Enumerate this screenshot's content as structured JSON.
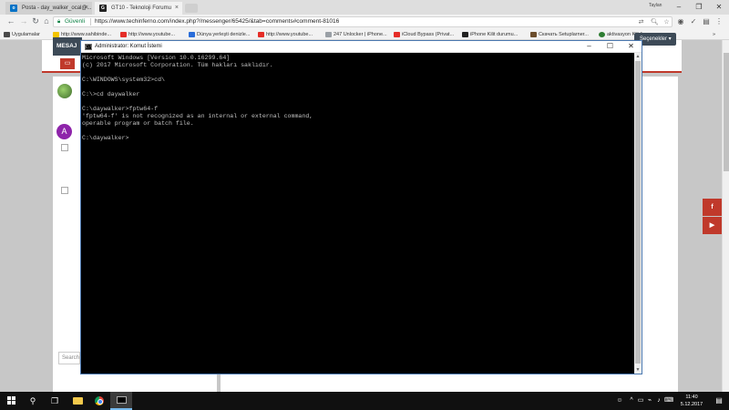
{
  "browser": {
    "tabs": [
      {
        "title": "Posta - day_walker_ocal@...",
        "active": false,
        "favicon": "outlook-icon"
      },
      {
        "title": "GT10 - Teknoloji Forumu",
        "active": true,
        "favicon": "gt-icon"
      }
    ],
    "user_label": "Taylan",
    "security_label": "Güvenli",
    "url": "https://www.techinferno.com/index.php?/messenger/65425/&tab=comments#comment-81016",
    "bookmarks": [
      {
        "label": "Uygulamalar",
        "icon": "apps-grid-icon",
        "color": "#4a4a4a"
      },
      {
        "label": "http://www.sahibinde...",
        "icon": "sahibinden-icon",
        "color": "#f4c400"
      },
      {
        "label": "http://www.youtube...",
        "icon": "youtube-icon",
        "color": "#e52d27"
      },
      {
        "label": "Dünya yerleşti denizle...",
        "icon": "doc-icon",
        "color": "#2a6dd9"
      },
      {
        "label": "http://www.youtube...",
        "icon": "youtube-icon",
        "color": "#e52d27"
      },
      {
        "label": "247 Unlocker | iPhone...",
        "icon": "unlocker-icon",
        "color": "#9aa0a6"
      },
      {
        "label": "iCloud Bypass (Privat...",
        "icon": "youtube-icon",
        "color": "#e52d27"
      },
      {
        "label": "iPhone Kilit durumu...",
        "icon": "apple-icon",
        "color": "#222222"
      },
      {
        "label": "Скачать Setuplarner...",
        "icon": "bookmark-icon",
        "color": "#6b4d2c"
      },
      {
        "label": "aktivasyon Kilidi",
        "icon": "green-circle-icon",
        "color": "#2e7d32"
      }
    ]
  },
  "website": {
    "section_label": "MESAJ",
    "options_label": "Seçenekler ▾",
    "search_placeholder": "Search",
    "avatar_letter": "A",
    "social": [
      "f",
      "▶"
    ]
  },
  "cmd": {
    "title": "Administrator: Komut İstemi",
    "lines": [
      "Microsoft Windows [Version 10.0.16299.64]",
      "(c) 2017 Microsoft Corporation. Tüm hakları saklıdır.",
      "",
      "C:\\WINDOWS\\system32>cd\\",
      "",
      "C:\\>cd daywalker",
      "",
      "C:\\daywalker>fptw64-f",
      "'fptw64-f' is not recognized as an internal or external command,",
      "operable program or batch file.",
      "",
      "C:\\daywalker>"
    ]
  },
  "taskbar": {
    "time": "11:40",
    "date": "5.12.2017"
  },
  "colors": {
    "accent_red": "#c0392b",
    "cmd_background": "#000000",
    "cmd_text": "#c0c0c0",
    "taskbar": "#101010"
  }
}
